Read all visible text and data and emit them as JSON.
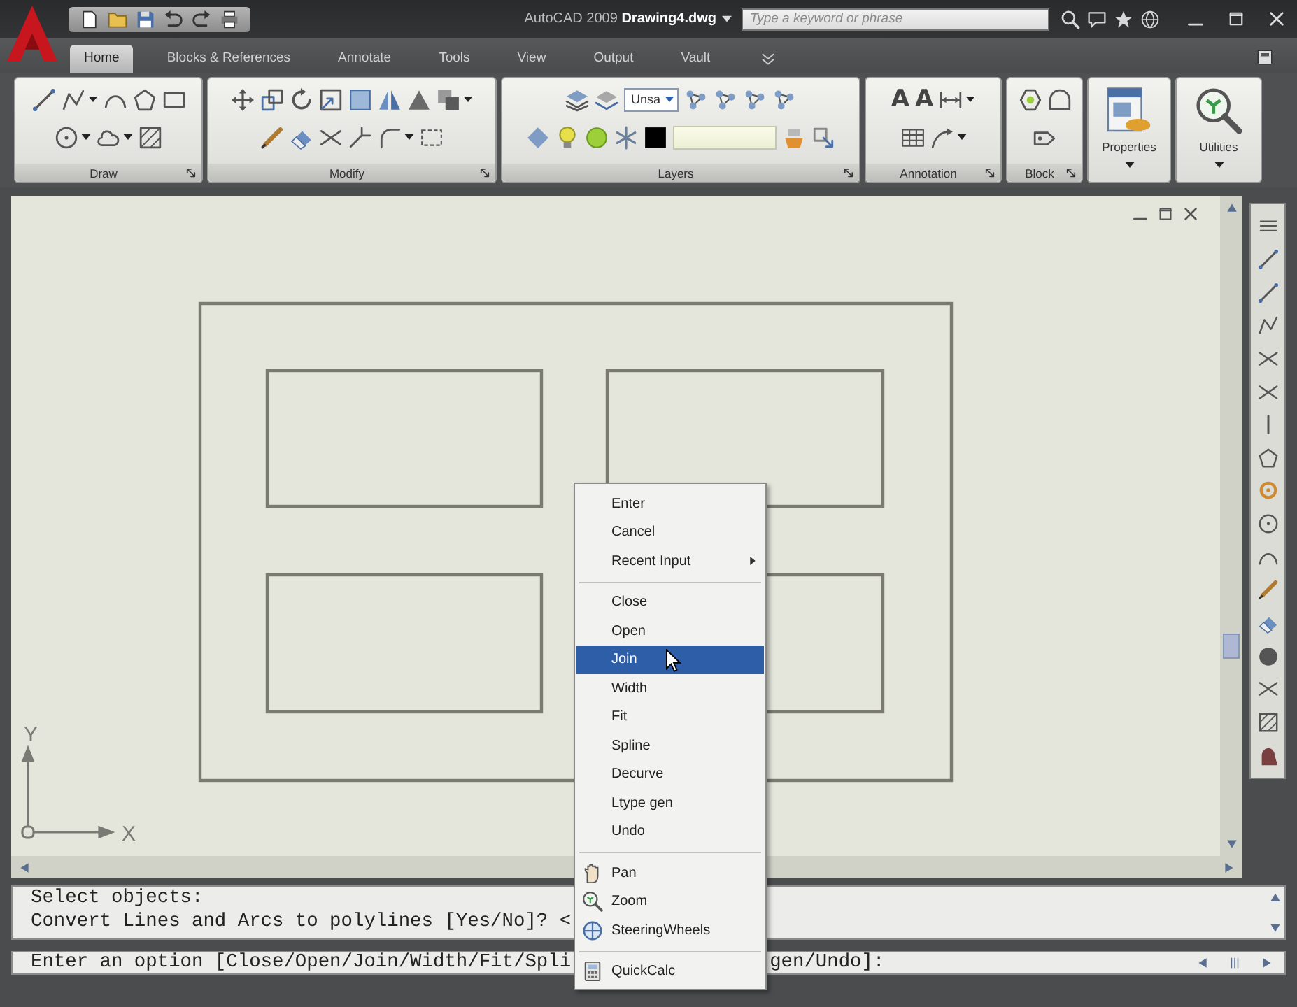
{
  "title_bar": {
    "title": "AutoCAD 2009 **Drawing4.dwg**",
    "search": {
      "placeholder": "Type a keyword or phrase"
    }
  },
  "tabs": [
    {
      "label": "Home",
      "selected": true
    },
    {
      "label": "Blocks & References",
      "selected": false
    },
    {
      "label": "Annotate",
      "selected": false
    },
    {
      "label": "Tools",
      "selected": false
    },
    {
      "label": "View",
      "selected": false
    },
    {
      "label": "Output",
      "selected": false
    },
    {
      "label": "Vault",
      "selected": false
    }
  ],
  "ribbon": {
    "panels": [
      {
        "kind": "tools",
        "title": "Draw"
      },
      {
        "kind": "tools",
        "title": "Modify"
      },
      {
        "kind": "tools",
        "title": "Layers",
        "dropdown": "Unsa"
      },
      {
        "kind": "tools",
        "title": "Annotation",
        "glyphs": [
          "A",
          "A"
        ]
      },
      {
        "kind": "tools",
        "title": "Block"
      },
      {
        "kind": "large",
        "label": "Properties"
      },
      {
        "kind": "large",
        "label": "Utilities"
      }
    ]
  },
  "canvas": {
    "ucs": {
      "y_label": "Y",
      "x_label": "X"
    }
  },
  "context_menu": {
    "groups": [
      [
        {
          "label": "Enter",
          "selected": false,
          "submenu": false
        },
        {
          "label": "Cancel",
          "selected": false,
          "submenu": false
        },
        {
          "label": "Recent Input",
          "selected": false,
          "submenu": true
        }
      ],
      [
        {
          "label": "Close",
          "selected": false,
          "submenu": false
        },
        {
          "label": "Open",
          "selected": false,
          "submenu": false
        },
        {
          "label": "Join",
          "selected": true,
          "submenu": false
        },
        {
          "label": "Width",
          "selected": false,
          "submenu": false
        },
        {
          "label": "Fit",
          "selected": false,
          "submenu": false
        },
        {
          "label": "Spline",
          "selected": false,
          "submenu": false
        },
        {
          "label": "Decurve",
          "selected": false,
          "submenu": false
        },
        {
          "label": "Ltype gen",
          "selected": false,
          "submenu": false
        },
        {
          "label": "Undo",
          "selected": false,
          "submenu": false
        }
      ],
      [
        {
          "label": "Pan",
          "selected": false,
          "submenu": false
        },
        {
          "label": "Zoom",
          "selected": false,
          "submenu": false
        },
        {
          "label": "SteeringWheels",
          "selected": false,
          "submenu": false
        }
      ],
      [
        {
          "label": "QuickCalc",
          "selected": false,
          "submenu": false
        }
      ]
    ]
  },
  "command_line": {
    "history": [
      "Select objects:",
      "Convert Lines and Arcs to polylines [Yes/No]? <"
    ],
    "prompt": [
      "Enter an option [Close/Open/Join/Width/Fit/Spli",
      "gen/Undo]:"
    ]
  }
}
